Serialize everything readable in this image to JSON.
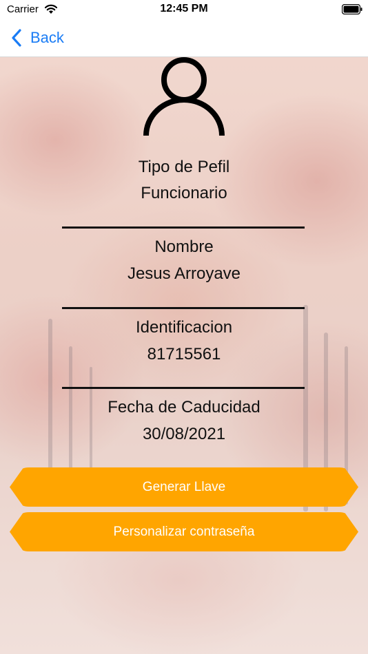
{
  "status_bar": {
    "carrier": "Carrier",
    "time": "12:45 PM"
  },
  "nav": {
    "back_label": "Back",
    "accent_color": "#1a7cf5"
  },
  "profile": {
    "profile_type_label": "Tipo de Pefil",
    "profile_type_value": "Funcionario",
    "name_label": "Nombre",
    "name_value": "Jesus Arroyave",
    "id_label": "Identificacion",
    "id_value": "81715561",
    "expiry_label": "Fecha de Caducidad",
    "expiry_value": "30/08/2021"
  },
  "actions": {
    "generate_key_label": "Generar Llave",
    "customize_password_label": "Personalizar contraseña",
    "button_color": "#ffa500"
  },
  "icons": [
    "wifi-icon",
    "battery-icon",
    "chevron-left-icon",
    "person-icon"
  ]
}
